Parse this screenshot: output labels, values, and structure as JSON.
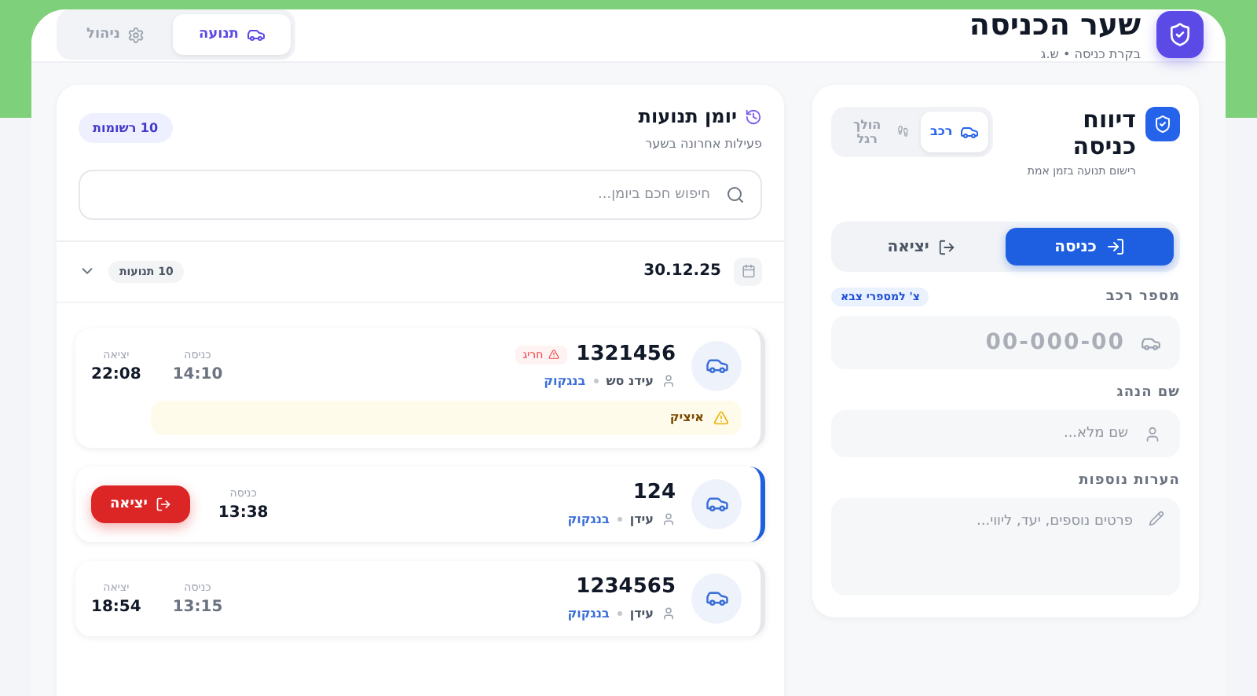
{
  "app": {
    "title": "שער הכניסה",
    "subtitle": "בקרת כניסה • ש.ג"
  },
  "nav_tabs": [
    {
      "label": "תנועה",
      "selected": true,
      "kind": "traffic"
    },
    {
      "label": "ניהול",
      "selected": false,
      "kind": "admin"
    }
  ],
  "report": {
    "title": "דיווח כניסה",
    "subtitle": "רישום תנועה בזמן אמת",
    "mode_tabs": [
      {
        "label": "רכב",
        "selected": true,
        "kind": "vehicle"
      },
      {
        "label": "הולך רגל",
        "selected": false,
        "kind": "pedestrian"
      }
    ],
    "direction_tabs": [
      {
        "label": "כניסה",
        "selected": true,
        "kind": "in"
      },
      {
        "label": "יציאה",
        "selected": false,
        "kind": "out"
      }
    ],
    "fields": [
      {
        "kind": "plate",
        "label": "מספר רכב",
        "badge": "צ' למספרי צבא",
        "placeholder": "00-000-00"
      },
      {
        "kind": "name",
        "label": "שם הנהג",
        "placeholder": "שם מלא..."
      },
      {
        "kind": "notes",
        "label": "הערות נוספות",
        "placeholder": "פרטים נוספים, יעד, ליווי..."
      }
    ]
  },
  "log": {
    "title": "יומן תנועות",
    "subtitle": "פעילות אחרונה בשער",
    "count": "10 רשומות",
    "search_placeholder": "חיפוש חכם ביומן...",
    "group": {
      "date": "30.12.25",
      "count": "10 תנועות",
      "expanded": true
    },
    "entries": [
      {
        "plate": "1321456",
        "tag": "חריג",
        "driver": "עידנ סש",
        "location": "בנגקוק",
        "entry_label": "כניסה",
        "entry_time": "14:10",
        "exit_label": "יציאה",
        "exit_time": "22:08",
        "note": "איציק",
        "selected": false
      },
      {
        "plate": "124",
        "driver": "עידן",
        "location": "בנגקוק",
        "entry_label": "כניסה",
        "entry_time": "13:38",
        "exit_button": "יציאה",
        "selected": true
      },
      {
        "plate": "1234565",
        "driver": "עידן",
        "location": "בנגקוק",
        "entry_label": "כניסה",
        "entry_time": "13:15",
        "exit_label": "יציאה",
        "exit_time": "18:54",
        "selected": false
      }
    ]
  }
}
